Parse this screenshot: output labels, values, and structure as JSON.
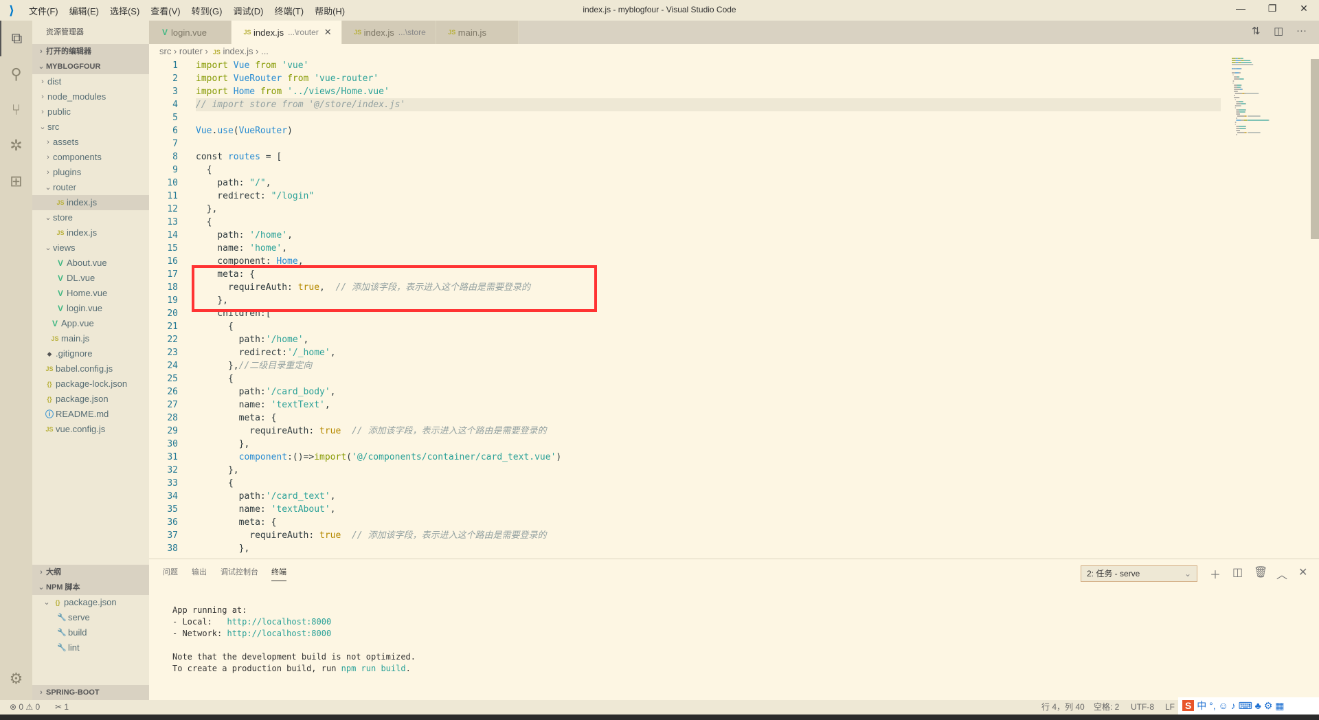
{
  "titlebar": {
    "title": "index.js - myblogfour - Visual Studio Code",
    "menu": [
      "文件(F)",
      "编辑(E)",
      "选择(S)",
      "查看(V)",
      "转到(G)",
      "调试(D)",
      "终端(T)",
      "帮助(H)"
    ]
  },
  "sidebar": {
    "title": "资源管理器",
    "open_editors": "打开的编辑器",
    "project": "MYBLOGFOUR",
    "tree": [
      {
        "label": "dist",
        "depth": 1,
        "type": "folder",
        "open": false
      },
      {
        "label": "node_modules",
        "depth": 1,
        "type": "folder",
        "open": false
      },
      {
        "label": "public",
        "depth": 1,
        "type": "folder",
        "open": false
      },
      {
        "label": "src",
        "depth": 1,
        "type": "folder",
        "open": true
      },
      {
        "label": "assets",
        "depth": 2,
        "type": "folder",
        "open": false
      },
      {
        "label": "components",
        "depth": 2,
        "type": "folder",
        "open": false
      },
      {
        "label": "plugins",
        "depth": 2,
        "type": "folder",
        "open": false
      },
      {
        "label": "router",
        "depth": 2,
        "type": "folder",
        "open": true
      },
      {
        "label": "index.js",
        "depth": 3,
        "type": "js",
        "selected": true
      },
      {
        "label": "store",
        "depth": 2,
        "type": "folder",
        "open": true
      },
      {
        "label": "index.js",
        "depth": 3,
        "type": "js"
      },
      {
        "label": "views",
        "depth": 2,
        "type": "folder",
        "open": true
      },
      {
        "label": "About.vue",
        "depth": 3,
        "type": "vue"
      },
      {
        "label": "DL.vue",
        "depth": 3,
        "type": "vue"
      },
      {
        "label": "Home.vue",
        "depth": 3,
        "type": "vue"
      },
      {
        "label": "login.vue",
        "depth": 3,
        "type": "vue"
      },
      {
        "label": "App.vue",
        "depth": 2,
        "type": "vue"
      },
      {
        "label": "main.js",
        "depth": 2,
        "type": "js"
      },
      {
        "label": ".gitignore",
        "depth": 1,
        "type": "git"
      },
      {
        "label": "babel.config.js",
        "depth": 1,
        "type": "js"
      },
      {
        "label": "package-lock.json",
        "depth": 1,
        "type": "json"
      },
      {
        "label": "package.json",
        "depth": 1,
        "type": "json"
      },
      {
        "label": "README.md",
        "depth": 1,
        "type": "info"
      },
      {
        "label": "vue.config.js",
        "depth": 1,
        "type": "js"
      }
    ],
    "outline": "大纲",
    "npm": "NPM 脚本",
    "npm_package": "package.json",
    "scripts": [
      "serve",
      "build",
      "lint"
    ],
    "spring": "SPRING-BOOT DASHBOARD"
  },
  "tabs": [
    {
      "label": "login.vue",
      "desc": "",
      "type": "vue"
    },
    {
      "label": "index.js",
      "desc": "...\\router",
      "type": "js",
      "active": true
    },
    {
      "label": "index.js",
      "desc": "...\\store",
      "type": "js"
    },
    {
      "label": "main.js",
      "desc": "",
      "type": "js"
    }
  ],
  "breadcrumb": [
    "src",
    "router",
    "index.js",
    "..."
  ],
  "editor": {
    "current_line": 4,
    "lines": [
      [
        [
          "k",
          "import "
        ],
        [
          "v",
          "Vue "
        ],
        [
          "k",
          "from "
        ],
        [
          "s",
          "'vue'"
        ]
      ],
      [
        [
          "k",
          "import "
        ],
        [
          "v",
          "VueRouter "
        ],
        [
          "k",
          "from "
        ],
        [
          "s",
          "'vue-router'"
        ]
      ],
      [
        [
          "k",
          "import "
        ],
        [
          "v",
          "Home "
        ],
        [
          "k",
          "from "
        ],
        [
          "s",
          "'../views/Home.vue'"
        ]
      ],
      [
        [
          "c",
          "// import store from '@/store/index.js'"
        ]
      ],
      [],
      [
        [
          "v",
          "Vue"
        ],
        [
          "p",
          "."
        ],
        [
          "v",
          "use"
        ],
        [
          "p",
          "("
        ],
        [
          "v",
          "VueRouter"
        ],
        [
          "p",
          ")"
        ]
      ],
      [],
      [
        [
          "p",
          "const "
        ],
        [
          "v",
          "routes "
        ],
        [
          "p",
          "= ["
        ]
      ],
      [
        [
          "p",
          "  {"
        ]
      ],
      [
        [
          "p",
          "    path: "
        ],
        [
          "s",
          "\"/\""
        ],
        [
          "p",
          ","
        ]
      ],
      [
        [
          "p",
          "    redirect: "
        ],
        [
          "s",
          "\"/login\""
        ]
      ],
      [
        [
          "p",
          "  },"
        ]
      ],
      [
        [
          "p",
          "  {"
        ]
      ],
      [
        [
          "p",
          "    path: "
        ],
        [
          "s",
          "'/home'"
        ],
        [
          "p",
          ","
        ]
      ],
      [
        [
          "p",
          "    name: "
        ],
        [
          "s",
          "'home'"
        ],
        [
          "p",
          ","
        ]
      ],
      [
        [
          "p",
          "    component: "
        ],
        [
          "v",
          "Home"
        ],
        [
          "p",
          ","
        ]
      ],
      [
        [
          "p",
          "    meta: {"
        ]
      ],
      [
        [
          "p",
          "      requireAuth: "
        ],
        [
          "b",
          "true"
        ],
        [
          "p",
          ",  "
        ],
        [
          "c",
          "// 添加该字段，表示进入这个路由是需要登录的"
        ]
      ],
      [
        [
          "p",
          "    },"
        ]
      ],
      [
        [
          "p",
          "    children:["
        ]
      ],
      [
        [
          "p",
          "      {"
        ]
      ],
      [
        [
          "p",
          "        path:"
        ],
        [
          "s",
          "'/home'"
        ],
        [
          "p",
          ","
        ]
      ],
      [
        [
          "p",
          "        redirect:"
        ],
        [
          "s",
          "'/_home'"
        ],
        [
          "p",
          ","
        ]
      ],
      [
        [
          "p",
          "      },"
        ],
        [
          "c",
          "//二级目录重定向"
        ]
      ],
      [
        [
          "p",
          "      {"
        ]
      ],
      [
        [
          "p",
          "        path:"
        ],
        [
          "s",
          "'/card_body'"
        ],
        [
          "p",
          ","
        ]
      ],
      [
        [
          "p",
          "        name: "
        ],
        [
          "s",
          "'textText'"
        ],
        [
          "p",
          ","
        ]
      ],
      [
        [
          "p",
          "        meta: {"
        ]
      ],
      [
        [
          "p",
          "          requireAuth: "
        ],
        [
          "b",
          "true"
        ],
        [
          "p",
          "  "
        ],
        [
          "c",
          "// 添加该字段，表示进入这个路由是需要登录的"
        ]
      ],
      [
        [
          "p",
          "        },"
        ]
      ],
      [
        [
          "v",
          "        component"
        ],
        [
          "p",
          ":()=>"
        ],
        [
          "k",
          "import"
        ],
        [
          "p",
          "("
        ],
        [
          "s",
          "'@/components/container/card_text.vue'"
        ],
        [
          "p",
          ")"
        ]
      ],
      [
        [
          "p",
          "      },"
        ]
      ],
      [
        [
          "p",
          "      {"
        ]
      ],
      [
        [
          "p",
          "        path:"
        ],
        [
          "s",
          "'/card_text'"
        ],
        [
          "p",
          ","
        ]
      ],
      [
        [
          "p",
          "        name: "
        ],
        [
          "s",
          "'textAbout'"
        ],
        [
          "p",
          ","
        ]
      ],
      [
        [
          "p",
          "        meta: {"
        ]
      ],
      [
        [
          "p",
          "          requireAuth: "
        ],
        [
          "b",
          "true"
        ],
        [
          "p",
          "  "
        ],
        [
          "c",
          "// 添加该字段，表示进入这个路由是需要登录的"
        ]
      ],
      [
        [
          "p",
          "        },"
        ]
      ]
    ]
  },
  "panel": {
    "tabs": [
      "问题",
      "输出",
      "调试控制台",
      "终端"
    ],
    "active": "终端",
    "terminal_select": "2: 任务 - serve",
    "terminal": {
      "l1": "App running at:",
      "l2a": "- Local:   ",
      "l2b": "http://localhost:8000",
      "l3a": "- Network: ",
      "l3b": "http://localhost:8000",
      "l4": "Note that the development build is not optimized.",
      "l5a": "To create a production build, run ",
      "l5b": "npm run build",
      "l5c": "."
    }
  },
  "status": {
    "errors": "0",
    "warnings": "0",
    "tasks": "1",
    "position": "行 4，列 40",
    "spaces": "空格: 2",
    "encoding": "UTF-8",
    "eol": "LF"
  },
  "colors": {
    "editor_bg": "#fdf6e3",
    "sidebar_bg": "#eee8d5",
    "highlight_box": "#ff3333",
    "accent": "#007acc"
  }
}
